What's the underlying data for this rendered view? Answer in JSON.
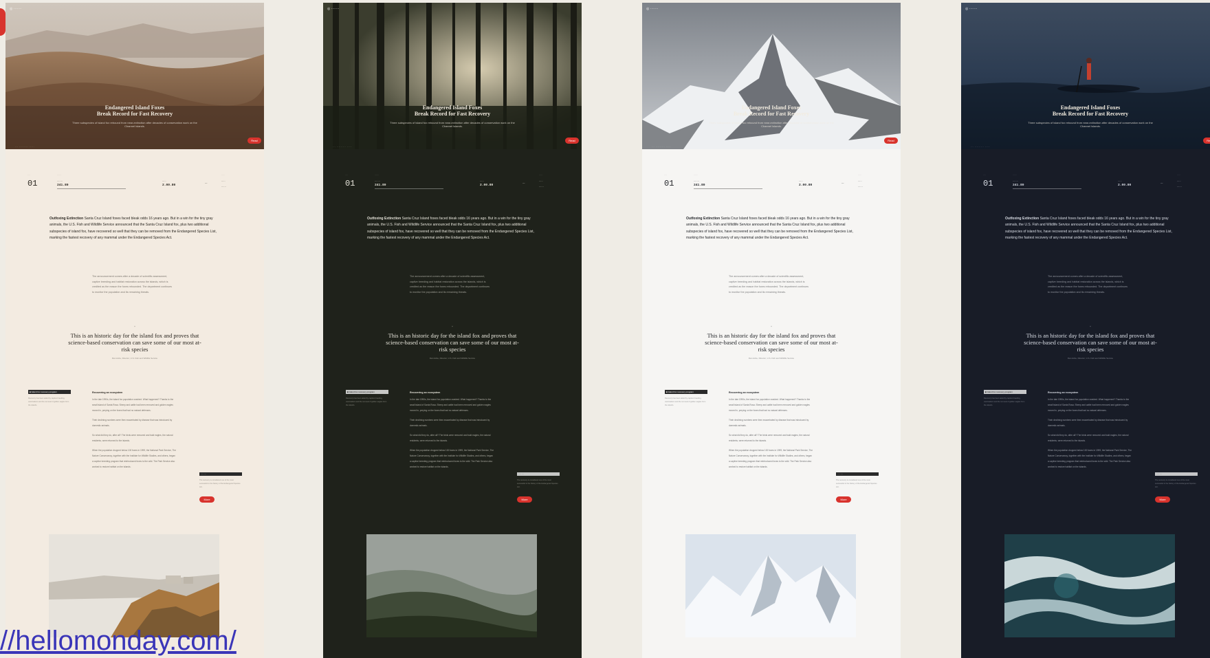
{
  "page": {
    "background": "#efece5",
    "accent": "#d8332d",
    "url_link": "//hellomonday.com/"
  },
  "variants": [
    {
      "theme": "sand",
      "bg": "#f3ebe1",
      "text": "#2a2620",
      "hero_image": "desert-dunes",
      "photo_image": "cliff-village"
    },
    {
      "theme": "forest",
      "bg": "#1f221b",
      "text": "#e6e4da",
      "hero_image": "pine-forest",
      "photo_image": "misty-forest-hill"
    },
    {
      "theme": "snow",
      "bg": "#f6f5f3",
      "text": "#24262a",
      "hero_image": "snowy-peak",
      "photo_image": "snowy-ridges"
    },
    {
      "theme": "night",
      "bg": "#181c27",
      "text": "#dadee6",
      "hero_image": "ocean-paddleboarder",
      "photo_image": "ocean-waves"
    }
  ],
  "article": {
    "hero_title": "Endangered Island Foxes\nBreak Record for Fast Recovery",
    "hero_subtitle": "Three subspecies of island fox rebound from near-extinction after decades of conservation work on the Channel Islands.",
    "hero_button": "Read",
    "topbar_label": "◎ ·······",
    "bottombar_label": "··· ·········    ·····",
    "stat_number": "01",
    "stat_labels": [
      "····",
      "······",
      "·····"
    ],
    "stat_left_small": "·······",
    "stat_left_big": "241.80",
    "stat_mid_small": "·····",
    "stat_mid_big": "2.00.80",
    "stat_right_small": [
      "·····",
      "······"
    ],
    "lead_bold": "Outfoxing Extinction",
    "lead_text": "Santa Cruz Island foxes faced bleak odds 16 years ago. But in a win for the tiny gray animals, the U.S. Fish and Wildlife Service announced that the Santa Cruz Island fox, plus two additional subspecies of island fox, have recovered so well that they can be removed from the Endangered Species List, marking the fastest recovery of any mammal under the Endangered Species Act.",
    "sidenote": "The announcement comes after a decade of scientific assessment, captive breeding and habitat restoration across the islands, which is credited as the reason the foxes rebounded. The department continues to monitor the population and its remaining threats.",
    "quote_mark": "”",
    "quote": "This is an historic day for the island fox and proves that science-based conservation can save some of our most at-risk species",
    "attribution": "Dan Ashe, Director, U.S. Fish and Wildlife Service",
    "tag_label": "■ Island fox recovery program",
    "tag_text": "Recovery has been aided by captive breeding, vaccinations and the removal of golden eagles from the islands.",
    "body_head": "Recovering an ecosystem",
    "body_paragraphs": [
      "In the late 1990s, the island fox population crashed. What happened? Thanks to the small island of Santa Rosa. Sheep and cattle had been removed and golden eagles moved in, preying on the foxes that had no natural defenses.",
      "Their declining numbers were then exacerbated by disease that was introduced by domestic animals.",
      "So what did they do, after all? The birds were removed and bald eagles, the natural residents, were returned to the islands.",
      "When the population dropped below 100 foxes in 1999, the National Park Service, The Nature Conservancy, together with the Institute for Wildlife Studies, and others, began a captive breeding program that reintroduced foxes to the wild. The Park Service also worked to restore habitat on the islands."
    ],
    "aside_tag": "···· ···",
    "aside_text": "The recovery is considered one of the most successful in the history of the Endangered Species Act.",
    "aside_button": "More"
  }
}
